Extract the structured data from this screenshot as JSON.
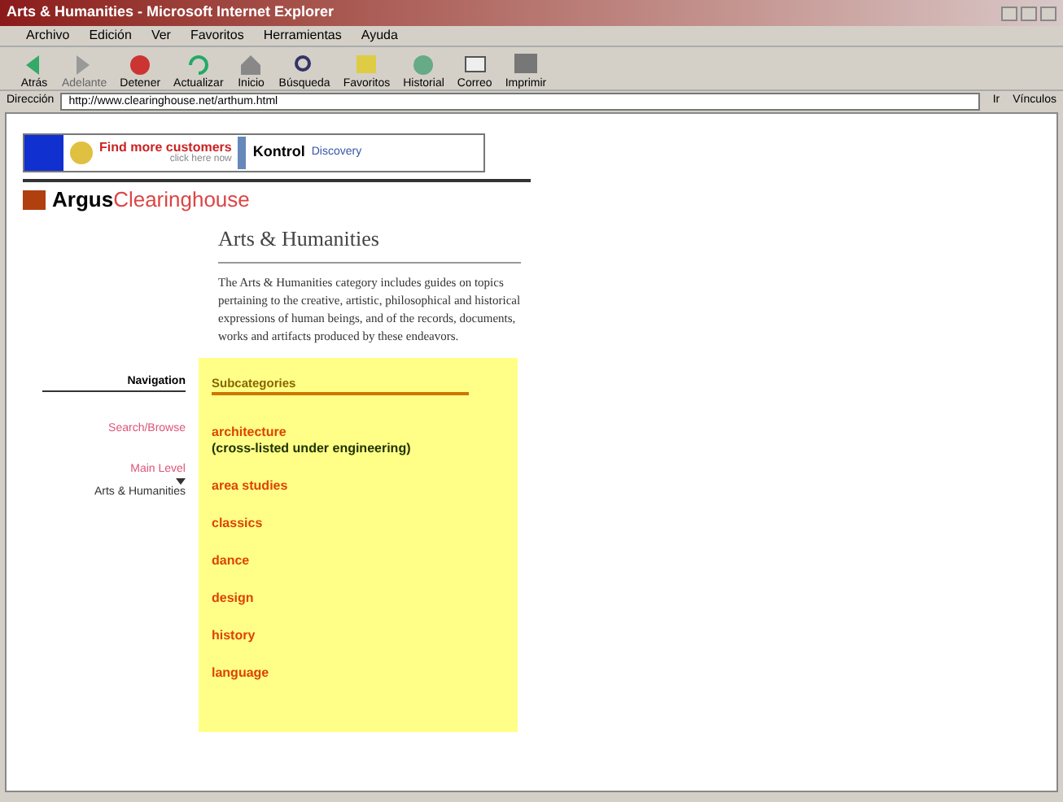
{
  "window": {
    "title": "Arts & Humanities - Microsoft Internet Explorer"
  },
  "menu": [
    "Archivo",
    "Edición",
    "Ver",
    "Favoritos",
    "Herramientas",
    "Ayuda"
  ],
  "toolbar": [
    {
      "label": "Atrás",
      "disabled": false
    },
    {
      "label": "Adelante",
      "disabled": true
    },
    {
      "label": "Detener",
      "disabled": false
    },
    {
      "label": "Actualizar",
      "disabled": false
    },
    {
      "label": "Inicio",
      "disabled": false
    },
    {
      "label": "Búsqueda",
      "disabled": false
    },
    {
      "label": "Favoritos",
      "disabled": false
    },
    {
      "label": "Historial",
      "disabled": false
    },
    {
      "label": "Correo",
      "disabled": false
    },
    {
      "label": "Imprimir",
      "disabled": false
    }
  ],
  "address": {
    "label": "Dirección",
    "value": "http://www.clearinghouse.net/arthum.html",
    "go": "Ir",
    "links": "Vínculos"
  },
  "banner": {
    "headline": "Find more customers",
    "subline": "click here now",
    "brand": "Kontrol",
    "tag": "Discovery"
  },
  "logo": {
    "first": "Argus",
    "second": "Clearinghouse"
  },
  "page": {
    "heading": "Arts & Humanities",
    "description": "The Arts & Humanities category includes guides on topics pertaining to the creative, artistic, philosophical and historical expressions of human beings, and of the records, documents, works and artifacts produced by these endeavors."
  },
  "navigation": {
    "title": "Navigation",
    "links": [
      "Search/Browse",
      "Main Level"
    ],
    "current": "Arts & Humanities"
  },
  "subcategories": {
    "title": "Subcategories",
    "items": [
      {
        "name": "architecture",
        "note": "(cross-listed under engineering)"
      },
      {
        "name": "area studies"
      },
      {
        "name": "classics"
      },
      {
        "name": "dance"
      },
      {
        "name": "design"
      },
      {
        "name": "history"
      },
      {
        "name": "language"
      }
    ]
  }
}
